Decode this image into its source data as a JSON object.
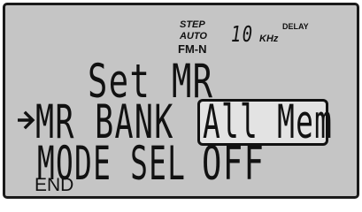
{
  "indicators": {
    "step": "STEP",
    "auto": "AUTO",
    "mode": "FM-N",
    "step_value": "10",
    "step_unit": "KHz",
    "delay": "DELAY"
  },
  "menu": {
    "title": "Set MR",
    "rows": [
      {
        "label": "MR BANK",
        "value": "All Mem",
        "selected": true
      },
      {
        "label": "MODE SEL",
        "value": "OFF",
        "selected": false
      }
    ],
    "footer": "END"
  },
  "colors": {
    "lcd_background": "#c5c5c5",
    "segment": "#111111",
    "highlight_box": "#e3e3e3"
  },
  "icons": {
    "cursor": "right-arrow-icon"
  }
}
